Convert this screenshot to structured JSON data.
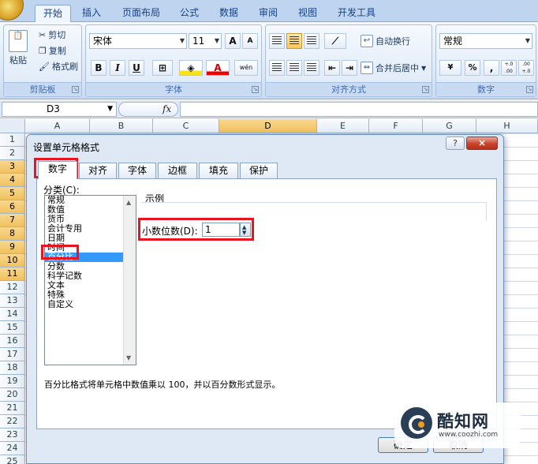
{
  "ribbon": {
    "tabs": [
      "开始",
      "插入",
      "页面布局",
      "公式",
      "数据",
      "审阅",
      "视图",
      "开发工具"
    ],
    "active_tab": "开始",
    "clipboard": {
      "paste": "粘贴",
      "cut": "剪切",
      "copy": "复制",
      "format_painter": "格式刷",
      "title": "剪贴板"
    },
    "font": {
      "name": "宋体",
      "size": "11",
      "grow": "A",
      "shrink": "A",
      "bold": "B",
      "italic": "I",
      "underline": "U",
      "color_letter": "A",
      "phonetic": "wén",
      "title": "字体"
    },
    "alignment": {
      "wrap": "自动换行",
      "merge": "合并后居中",
      "title": "对齐方式"
    },
    "number": {
      "format": "常规",
      "percent": "%",
      "comma": ",",
      "inc_decimal": "+.0 .00",
      "dec_decimal": ".00 +.0",
      "title": "数字"
    }
  },
  "formula_bar": {
    "cell_ref": "D3",
    "fx": "fx",
    "formula": ""
  },
  "grid": {
    "columns": [
      "A",
      "B",
      "C",
      "D",
      "E",
      "F",
      "G",
      "H"
    ],
    "selected_column": "D",
    "rows": [
      "1",
      "2",
      "3",
      "4",
      "5",
      "6",
      "7",
      "8",
      "9",
      "10",
      "11",
      "12",
      "13",
      "14",
      "15",
      "16",
      "17",
      "18",
      "19",
      "20",
      "21",
      "22",
      "23",
      "24",
      "25"
    ],
    "selected_rows": [
      "3",
      "4",
      "5",
      "6",
      "7",
      "8",
      "9",
      "10",
      "11"
    ]
  },
  "dialog": {
    "title": "设置单元格格式",
    "help": "?",
    "close": "×",
    "tabs": [
      "数字",
      "对齐",
      "字体",
      "边框",
      "填充",
      "保护"
    ],
    "active_tab": "数字",
    "category_label": "分类(C):",
    "categories": [
      "常规",
      "数值",
      "货币",
      "会计专用",
      "日期",
      "时间",
      "百分比",
      "分数",
      "科学记数",
      "文本",
      "特殊",
      "自定义"
    ],
    "selected_category": "百分比",
    "sample_label": "示例",
    "decimal_label": "小数位数(D):",
    "decimal_value": "1",
    "description": "百分比格式将单元格中数值乘以 100，并以百分数形式显示。",
    "ok": "确定",
    "cancel": "取消"
  },
  "watermark": {
    "name": "酷知网",
    "url": "www.coozhi.com"
  },
  "colors": {
    "annotation_red": "#e8141f",
    "selection_blue": "#3399ff",
    "header_highlight": "#f1c15f"
  }
}
